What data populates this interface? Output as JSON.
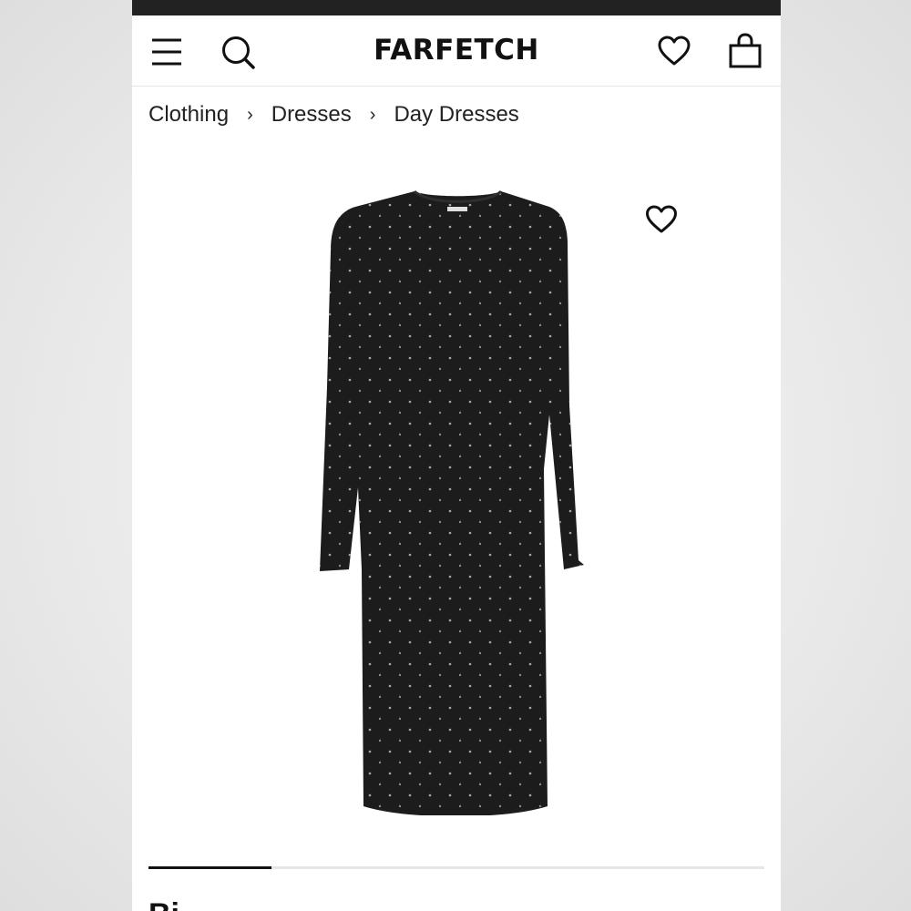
{
  "header": {
    "logo": "FARFETCH",
    "icons": [
      "menu-icon",
      "search-icon",
      "heart-icon",
      "bag-icon"
    ]
  },
  "breadcrumb": {
    "items": [
      "Clothing",
      "Dresses",
      "Day Dresses"
    ],
    "separator": "›"
  },
  "product": {
    "image_alt": "black long-sleeve studded day dress",
    "wishlist_icon": "heart-outline-icon",
    "title_partial": "Bi",
    "carousel_progress": 0.2
  },
  "colors": {
    "status_bar": "#222222",
    "text": "#111111",
    "dress": "#1c1c1c",
    "studs": "#9a9a9a"
  }
}
